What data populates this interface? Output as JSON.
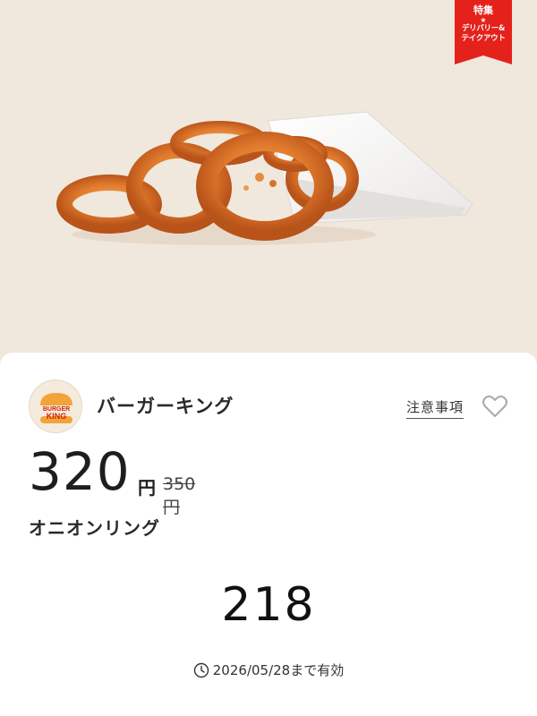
{
  "ribbon": {
    "title": "特集",
    "star": "★",
    "line1": "デリバリー&",
    "line2": "テイクアウト",
    "color": "#e4221b"
  },
  "brand": {
    "logo_top": "BURGER",
    "logo_bottom": "KING",
    "name": "バーガーキング"
  },
  "actions": {
    "notes_label": "注意事項",
    "favorite_icon": "heart-outline-icon"
  },
  "offer": {
    "price": "320",
    "currency": "円",
    "old_price": "350円",
    "product": "オニオンリング",
    "code": "218",
    "expiry_icon": "clock-icon",
    "expiry": "2026/05/28まで有効"
  }
}
